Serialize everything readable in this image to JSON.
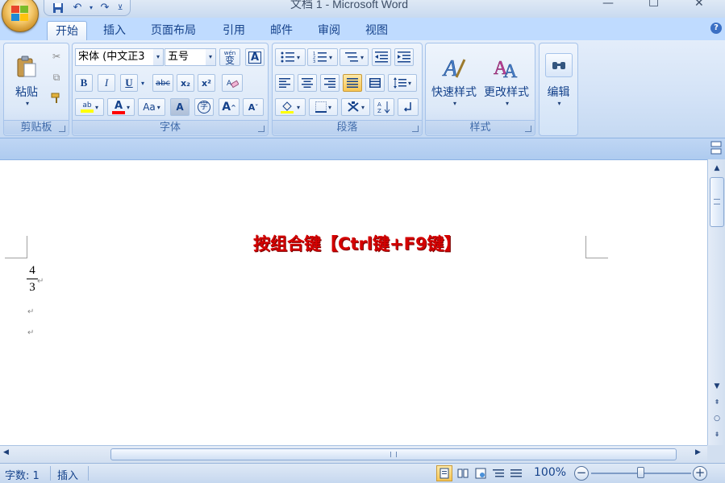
{
  "window": {
    "title": "文档 1 - Microsoft Word"
  },
  "qat": {
    "save_icon": "save-icon",
    "undo_icon": "undo-icon",
    "redo_icon": "redo-icon",
    "customize_icon": "customize-icon"
  },
  "tabs": [
    {
      "label": "开始",
      "active": true
    },
    {
      "label": "插入"
    },
    {
      "label": "页面布局"
    },
    {
      "label": "引用"
    },
    {
      "label": "邮件"
    },
    {
      "label": "审阅"
    },
    {
      "label": "视图"
    }
  ],
  "ribbon": {
    "clipboard": {
      "paste_label": "粘贴",
      "group_label": "剪贴板"
    },
    "font": {
      "font_name": "宋体 (中文正3",
      "font_size": "五号",
      "wen_label": "wén 变",
      "bold": "B",
      "italic": "I",
      "underline": "U",
      "strike": "abc",
      "subscript": "x₂",
      "superscript": "x²",
      "change_case": "Aa",
      "grow": "A",
      "shrink": "A",
      "group_label": "字体",
      "highlight_color": "#ffff00",
      "font_color": "#ff0000"
    },
    "paragraph": {
      "group_label": "段落"
    },
    "styles": {
      "quick_styles": "快速样式",
      "change_styles": "更改样式",
      "group_label": "样式"
    },
    "editing": {
      "label": "编辑"
    }
  },
  "document": {
    "heading": "按组合键【Ctrl键+F9键】",
    "fraction": {
      "numerator": "4",
      "denominator": "3"
    },
    "para_mark": "↵",
    "heading_color": "#d40000"
  },
  "status": {
    "word_count": "字数: 1",
    "insert_mode": "插入",
    "zoom": "100%"
  },
  "colors": {
    "ribbon_bg": "#d4e3f7",
    "accent": "#15428b"
  }
}
